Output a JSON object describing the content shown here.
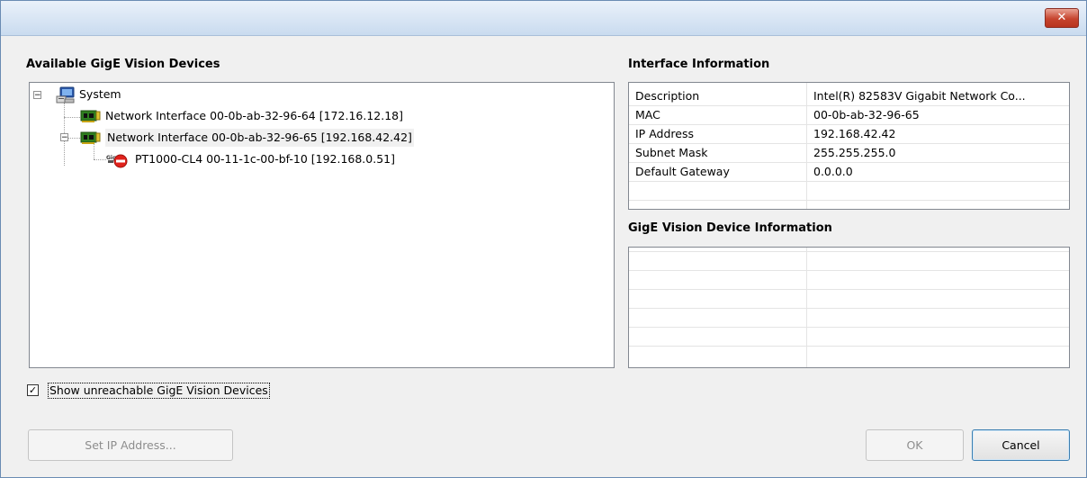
{
  "window": {
    "close_glyph": "✕"
  },
  "tree_panel": {
    "title": "Available GigE Vision Devices",
    "nodes": {
      "system": {
        "label": "System",
        "icon": "computer-icon",
        "expander": "−"
      },
      "nic1": {
        "label": "Network Interface  00-0b-ab-32-96-64 [172.16.12.18]",
        "icon": "network-card-icon"
      },
      "nic2": {
        "label": "Network Interface  00-0b-ab-32-96-65 [192.168.42.42]",
        "icon": "network-card-icon",
        "expander": "−"
      },
      "device": {
        "label": "PT1000-CL4 00-11-1c-00-bf-10 [192.168.0.51]",
        "icon": "unreachable-camera-icon"
      }
    }
  },
  "interface_info": {
    "title": "Interface Information",
    "rows": [
      {
        "key": "Description",
        "value": "Intel(R) 82583V Gigabit Network Co..."
      },
      {
        "key": "MAC",
        "value": "00-0b-ab-32-96-65"
      },
      {
        "key": "IP Address",
        "value": "192.168.42.42"
      },
      {
        "key": "Subnet Mask",
        "value": "255.255.255.0"
      },
      {
        "key": "Default Gateway",
        "value": "0.0.0.0"
      }
    ]
  },
  "device_info": {
    "title": "GigE Vision Device Information"
  },
  "options": {
    "show_unreachable_label": "Show unreachable GigE Vision Devices",
    "show_unreachable_checked": true,
    "check_glyph": "✓"
  },
  "buttons": {
    "set_ip": "Set IP Address...",
    "ok": "OK",
    "cancel": "Cancel"
  },
  "colors": {
    "title_bar": "#d6e4f5",
    "close_button": "#c6442e",
    "panel_bg": "#f0f0f0"
  }
}
